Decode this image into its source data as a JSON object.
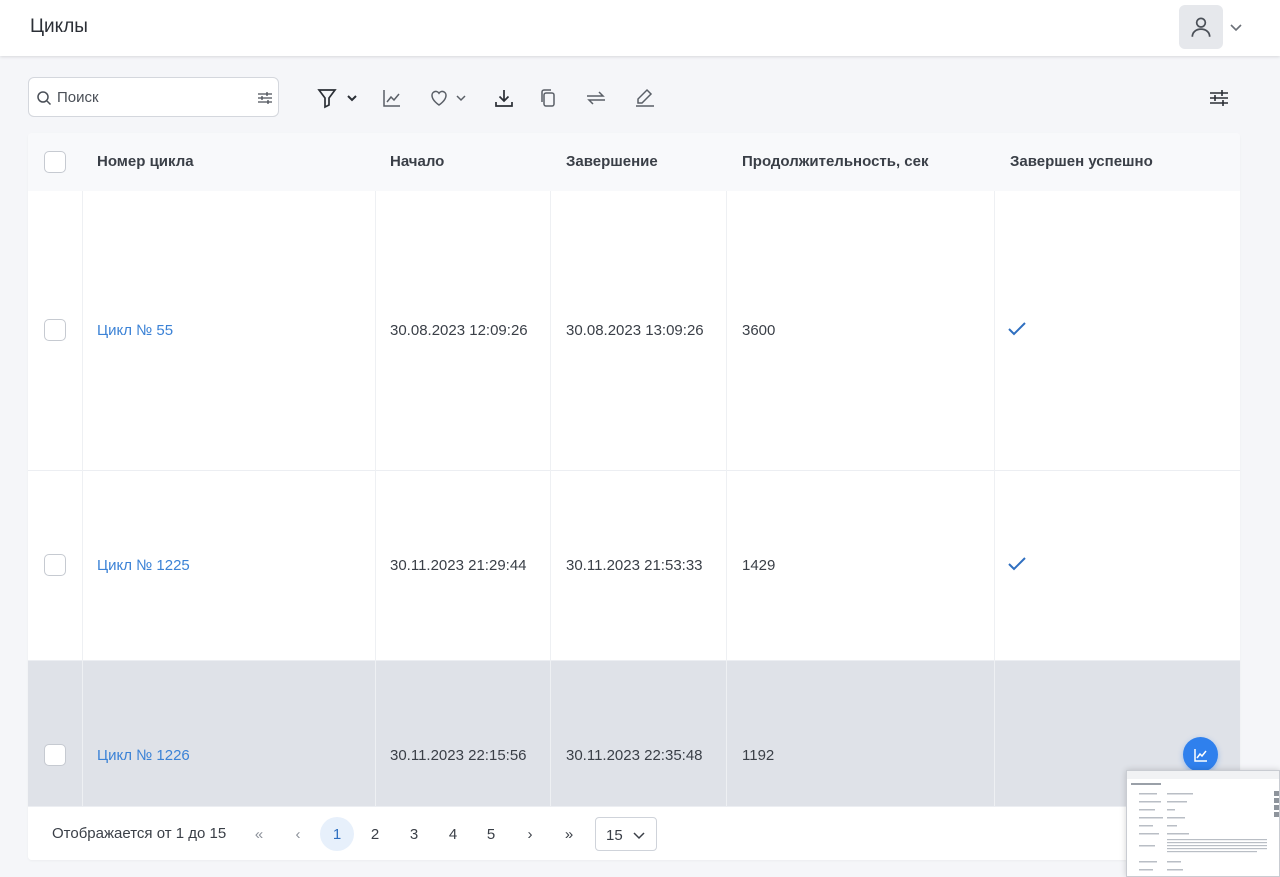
{
  "header": {
    "title": "Циклы"
  },
  "toolbar": {
    "search_placeholder": "Поиск"
  },
  "table": {
    "columns": [
      "Номер цикла",
      "Начало",
      "Завершение",
      "Продолжительность, сек",
      "Завершен успешно"
    ],
    "rows": [
      {
        "name": "Цикл № 55",
        "start": "30.08.2023 12:09:26",
        "end": "30.08.2023 13:09:26",
        "duration": "3600",
        "success": true
      },
      {
        "name": "Цикл № 1225",
        "start": "30.11.2023 21:29:44",
        "end": "30.11.2023 21:53:33",
        "duration": "1429",
        "success": true
      },
      {
        "name": "Цикл № 1226",
        "start": "30.11.2023 22:15:56",
        "end": "30.11.2023 22:35:48",
        "duration": "1192",
        "success": false
      }
    ]
  },
  "pagination": {
    "showing_text": "Отображается от 1 до 15",
    "first": "«",
    "prev": "‹",
    "pages": [
      "1",
      "2",
      "3",
      "4",
      "5"
    ],
    "current_page": "1",
    "next": "›",
    "last": "»",
    "page_size": "15"
  },
  "colors": {
    "accent": "#2f80ed",
    "link": "#3b82d6",
    "row_hover": "#dfe2e8"
  }
}
